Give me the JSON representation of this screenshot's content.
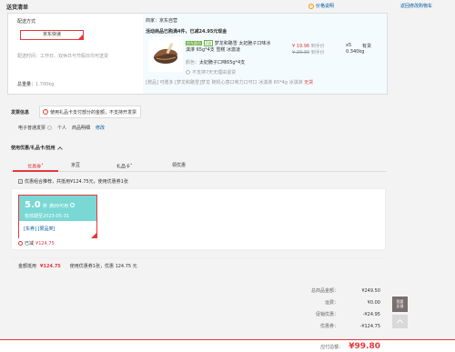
{
  "header": {
    "title": "送货清单",
    "price_note": "价格说明",
    "back_to_cart": "返回修改购物车"
  },
  "delivery": {
    "section_label": "配送方式",
    "option_label": "京东快递",
    "time_text": "配送时间：工作日、双休日与节假日均可送货",
    "weight_label": "总重量：",
    "weight_value": "1.700kg"
  },
  "merchant": {
    "label": "商家：",
    "name": "京东自营",
    "promo": "活动商品已购满4件，已减24.95元现金"
  },
  "product": {
    "badge_green": "京东超市",
    "badge_outline": "2减",
    "name": "梦龙和路雪 太妃脆子口味冰淇淋 65g*4支 雪糕 冰激凌",
    "price": "¥ 19.96",
    "price_tag": "到手价",
    "orig_price": "¥ 29.30",
    "orig_tag": "到手价",
    "qty": "x5",
    "stock": "有货",
    "weight": "0.340kg",
    "spec_label": "颜色：",
    "spec_value": "太妃脆子口味65g*4支",
    "no_return": "不支持7天无理由退货",
    "gift_tag": "[赠品]",
    "gift_text": "可赠多 [梦龙和路雪]梦龙 随机心意口味力口可口 冰淇淋 65*4g 冰淇淋",
    "gift_status": "无货"
  },
  "invoice": {
    "section_label": "发票信息",
    "notice": "使用礼品卡支付部分的金额，不支持开发票",
    "type": "电子普通发票",
    "title": "个人",
    "content": "商品明细",
    "edit": "修改"
  },
  "coupons": {
    "section_label": "使用优惠/礼品卡/抵用",
    "tabs": [
      "优惠券",
      "京豆",
      "礼品卡",
      "领优惠"
    ],
    "combo_text": "优惠组合推荐，共抵用¥124.75元，使用优惠券1张",
    "coupon_amount": "5.0",
    "coupon_unit": "券",
    "coupon_cond": "满99可用",
    "coupon_expire": "有效期至2023-05-31",
    "coupon_scope": "[东券] [限品类]",
    "used_label": "已减",
    "used_amount": "¥124.75",
    "summary_label": "金额抵用",
    "summary_amount": "¥124.75",
    "summary_text": "使用优惠券1张，优惠 124.75 元"
  },
  "totals": {
    "rows": [
      {
        "label": "总商品金额：",
        "value": "¥249.50"
      },
      {
        "label": "运费：",
        "value": "¥0.00"
      },
      {
        "label": "促销优惠：",
        "value": "-¥24.95"
      },
      {
        "label": "优惠券：",
        "value": "-¥124.75"
      }
    ],
    "payable_label": "应付总额：",
    "payable_value": "¥99.80"
  },
  "side": {
    "feedback": "我要\n反馈"
  },
  "colors": {
    "accent": "#e4393c",
    "coupon_bg": "#79d8d4",
    "green": "#71b247",
    "orange": "#f39800"
  }
}
